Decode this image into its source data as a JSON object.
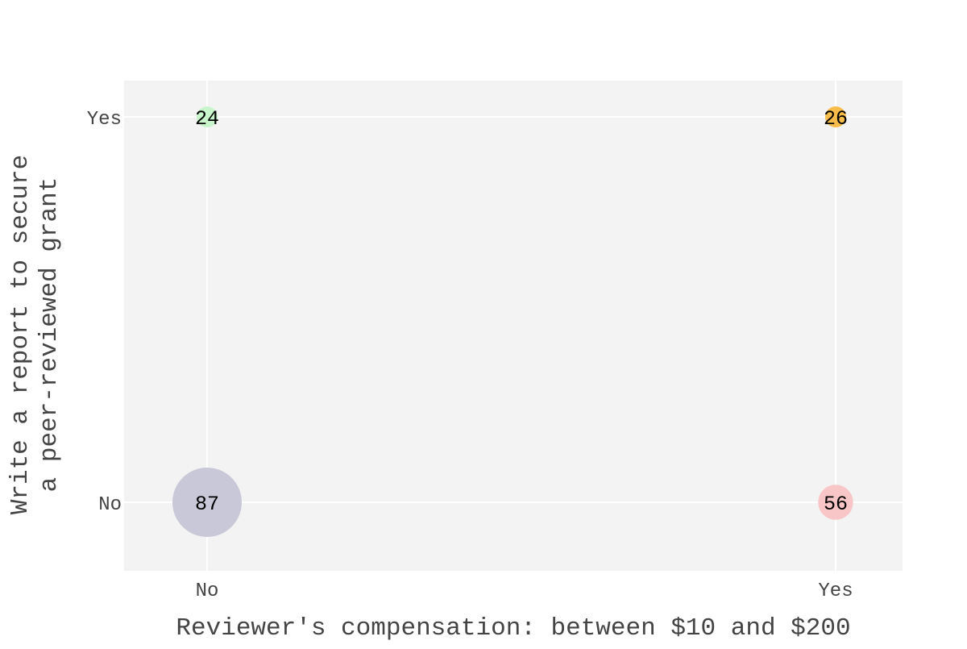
{
  "chart_data": {
    "type": "scatter",
    "x_categories": [
      "No",
      "Yes"
    ],
    "y_categories": [
      "No",
      "Yes"
    ],
    "xlabel": "Reviewer's compensation: between $10 and $200",
    "ylabel_lines": [
      "Write a report to secure",
      "a peer-reviewed grant"
    ],
    "points": [
      {
        "x": "No",
        "y": "Yes",
        "value": 24,
        "color": "#c8f5cc"
      },
      {
        "x": "Yes",
        "y": "Yes",
        "value": 26,
        "color": "#f8bc4a"
      },
      {
        "x": "No",
        "y": "No",
        "value": 87,
        "color": "#c8c8d8"
      },
      {
        "x": "Yes",
        "y": "No",
        "value": 56,
        "color": "#f8c6c6"
      }
    ],
    "grid": true,
    "plot_background": "#f3f3f3",
    "grid_color": "#ffffff"
  }
}
